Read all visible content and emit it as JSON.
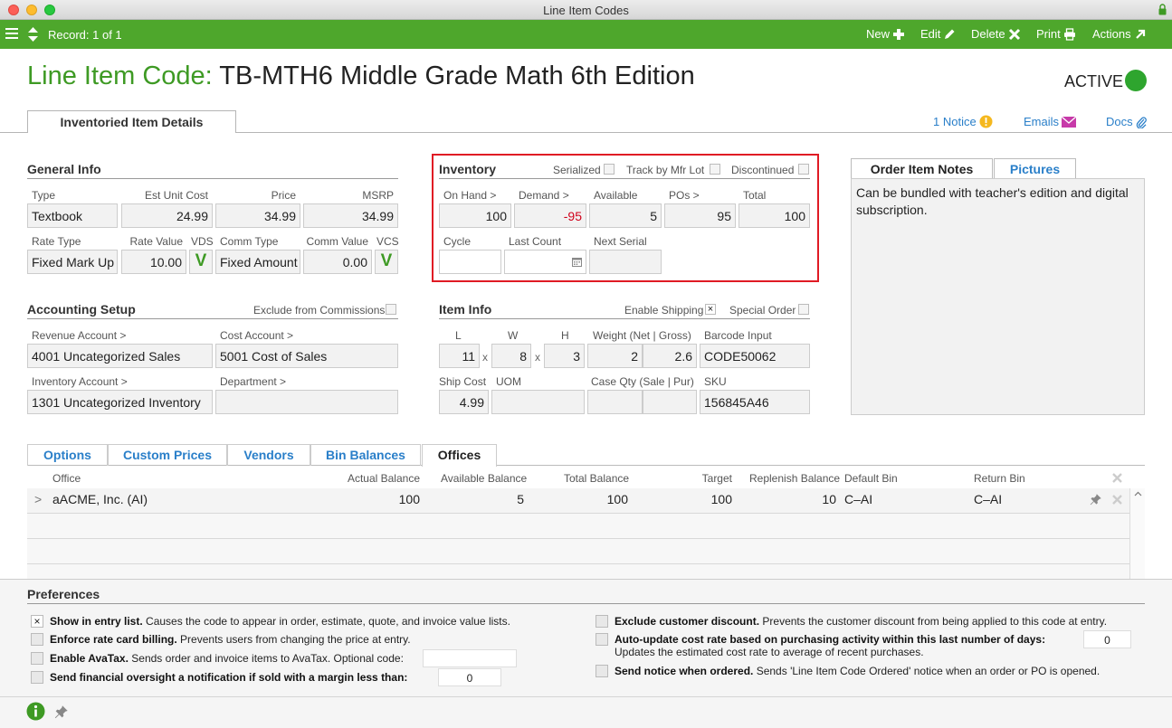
{
  "window": {
    "title": "Line Item Codes"
  },
  "toolbar": {
    "record": "Record: 1 of 1",
    "new": "New",
    "edit": "Edit",
    "delete": "Delete",
    "print": "Print",
    "actions": "Actions"
  },
  "header": {
    "title_label": "Line Item Code:",
    "title_value": "TB-MTH6 Middle Grade Math 6th Edition",
    "status": "ACTIVE",
    "tab": "Inventoried Item Details",
    "notice": "1 Notice",
    "emails": "Emails",
    "docs": "Docs"
  },
  "general": {
    "heading": "General Info",
    "type_label": "Type",
    "type": "Textbook",
    "cost_label": "Est Unit Cost",
    "cost": "24.99",
    "price_label": "Price",
    "price": "34.99",
    "msrp_label": "MSRP",
    "msrp": "34.99",
    "rate_type_label": "Rate Type",
    "rate_type": "Fixed Mark Up",
    "rate_value_label": "Rate Value",
    "rate_value": "10.00",
    "vds_label": "VDS",
    "vds": "V",
    "comm_type_label": "Comm Type",
    "comm_type": "Fixed Amount",
    "comm_value_label": "Comm Value",
    "comm_value": "0.00",
    "vcs_label": "VCS",
    "vcs": "V"
  },
  "inventory": {
    "heading": "Inventory",
    "serialized": "Serialized",
    "track_mfr": "Track by Mfr Lot",
    "discontinued": "Discontinued",
    "on_hand_label": "On Hand >",
    "on_hand": "100",
    "demand_label": "Demand >",
    "demand": "-95",
    "available_label": "Available",
    "available": "5",
    "pos_label": "POs >",
    "pos": "95",
    "total_label": "Total",
    "total": "100",
    "cycle_label": "Cycle",
    "last_count_label": "Last Count",
    "next_serial_label": "Next Serial"
  },
  "notes": {
    "tab_notes": "Order Item Notes",
    "tab_pictures": "Pictures",
    "text": "Can be bundled with teacher's edition and digital subscription."
  },
  "accounting": {
    "heading": "Accounting Setup",
    "exclude_commissions": "Exclude from Commissions",
    "revenue_label": "Revenue Account >",
    "revenue": "4001 Uncategorized Sales",
    "cost_account_label": "Cost Account >",
    "cost_account": "5001 Cost of Sales",
    "inventory_label": "Inventory Account >",
    "inventory_account": "1301 Uncategorized Inventory",
    "department_label": "Department >"
  },
  "item_info": {
    "heading": "Item Info",
    "enable_shipping": "Enable Shipping",
    "special_order": "Special Order",
    "l_label": "L",
    "l": "11",
    "w_label": "W",
    "w": "8",
    "h_label": "H",
    "h": "3",
    "x": "x",
    "weight_label": "Weight (Net | Gross)",
    "weight_net": "2",
    "weight_gross": "2.6",
    "barcode_label": "Barcode Input",
    "barcode": "CODE50062",
    "ship_cost_label": "Ship Cost",
    "ship_cost": "4.99",
    "uom_label": "UOM",
    "case_qty_label": "Case Qty (Sale | Pur)",
    "sku_label": "SKU",
    "sku": "156845A46"
  },
  "lower_tabs": [
    "Options",
    "Custom Prices",
    "Vendors",
    "Bin Balances",
    "Offices"
  ],
  "offices_table": {
    "headers": [
      "Office",
      "Actual Balance",
      "Available Balance",
      "Total Balance",
      "Target",
      "Replenish Balance",
      "Default Bin",
      "Return Bin"
    ],
    "rows": [
      {
        "office": "aACME, Inc.  (AI)",
        "actual": "100",
        "available": "5",
        "total": "100",
        "target": "100",
        "replenish": "10",
        "default_bin": "C–AI",
        "return_bin": "C–AI"
      }
    ],
    "expander": ">"
  },
  "preferences": {
    "heading": "Preferences",
    "show_entry_bold": "Show in entry list.",
    "show_entry_rest": "Causes the code to appear in order, estimate, quote, and invoice value lists.",
    "enforce_bold": "Enforce rate card billing.",
    "enforce_rest": "Prevents users from changing the price at entry.",
    "avatax_bold": "Enable AvaTax.",
    "avatax_rest": "Sends order and invoice items to AvaTax. Optional code:",
    "oversight_bold": "Send financial oversight a notification if sold with a margin less than:",
    "oversight_value": "0",
    "exclude_bold": "Exclude customer discount.",
    "exclude_rest": "Prevents the customer discount from being applied to this code at entry.",
    "autoupdate_bold": "Auto-update cost rate based on purchasing activity within this last number of days:",
    "autoupdate_rest": "Updates the estimated cost rate to average of recent purchases.",
    "autoupdate_value": "0",
    "notice_bold": "Send notice when ordered.",
    "notice_rest": "Sends 'Line Item Code Ordered' notice when an order or PO is opened."
  },
  "colors": {
    "green": "#4ea72c",
    "link": "#2a7fc9",
    "alert": "#e01b24"
  }
}
